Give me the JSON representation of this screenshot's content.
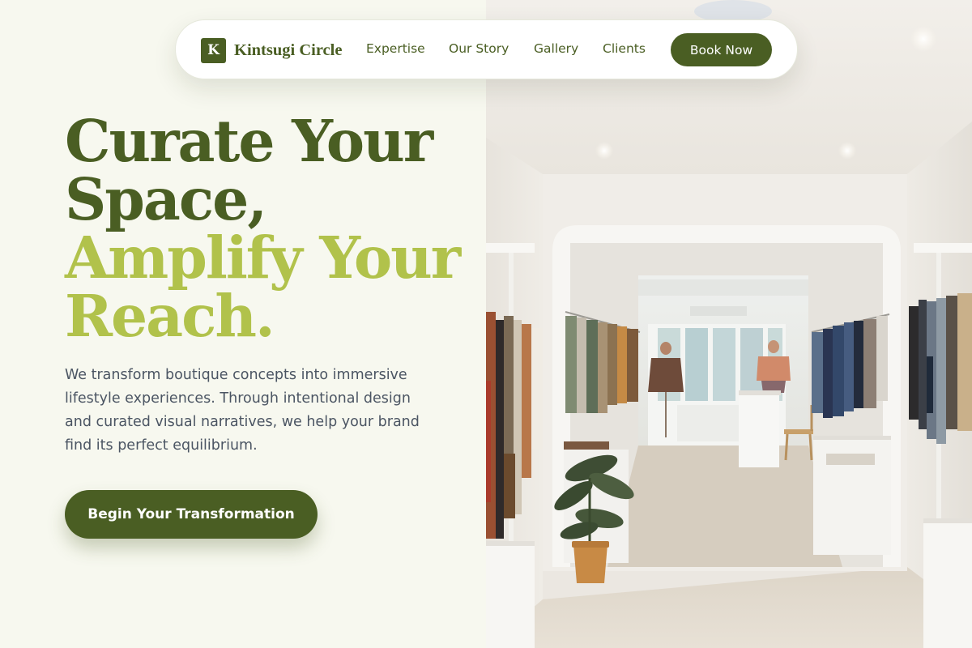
{
  "nav": {
    "brand_mark": "K",
    "brand_name": "Kintsugi Circle",
    "links": [
      {
        "label": "Expertise"
      },
      {
        "label": "Our Story"
      },
      {
        "label": "Gallery"
      },
      {
        "label": "Clients"
      }
    ],
    "cta_label": "Book Now"
  },
  "hero": {
    "headline_lines": [
      "Curate Your",
      "Space,",
      "Amplify Your",
      "Reach."
    ],
    "description": "We transform boutique concepts into immersive lifestyle experiences. Through intentional design and curated visual narratives, we help your brand find its perfect equilibrium.",
    "cta_label": "Begin Your Transformation"
  },
  "image": {
    "subject": "boutique-interior-photo"
  },
  "colors": {
    "brand_dark": "#4a5e23",
    "brand_light": "#b1c24b",
    "page_background": "#f7f8ef",
    "body_text": "#4b5563"
  }
}
